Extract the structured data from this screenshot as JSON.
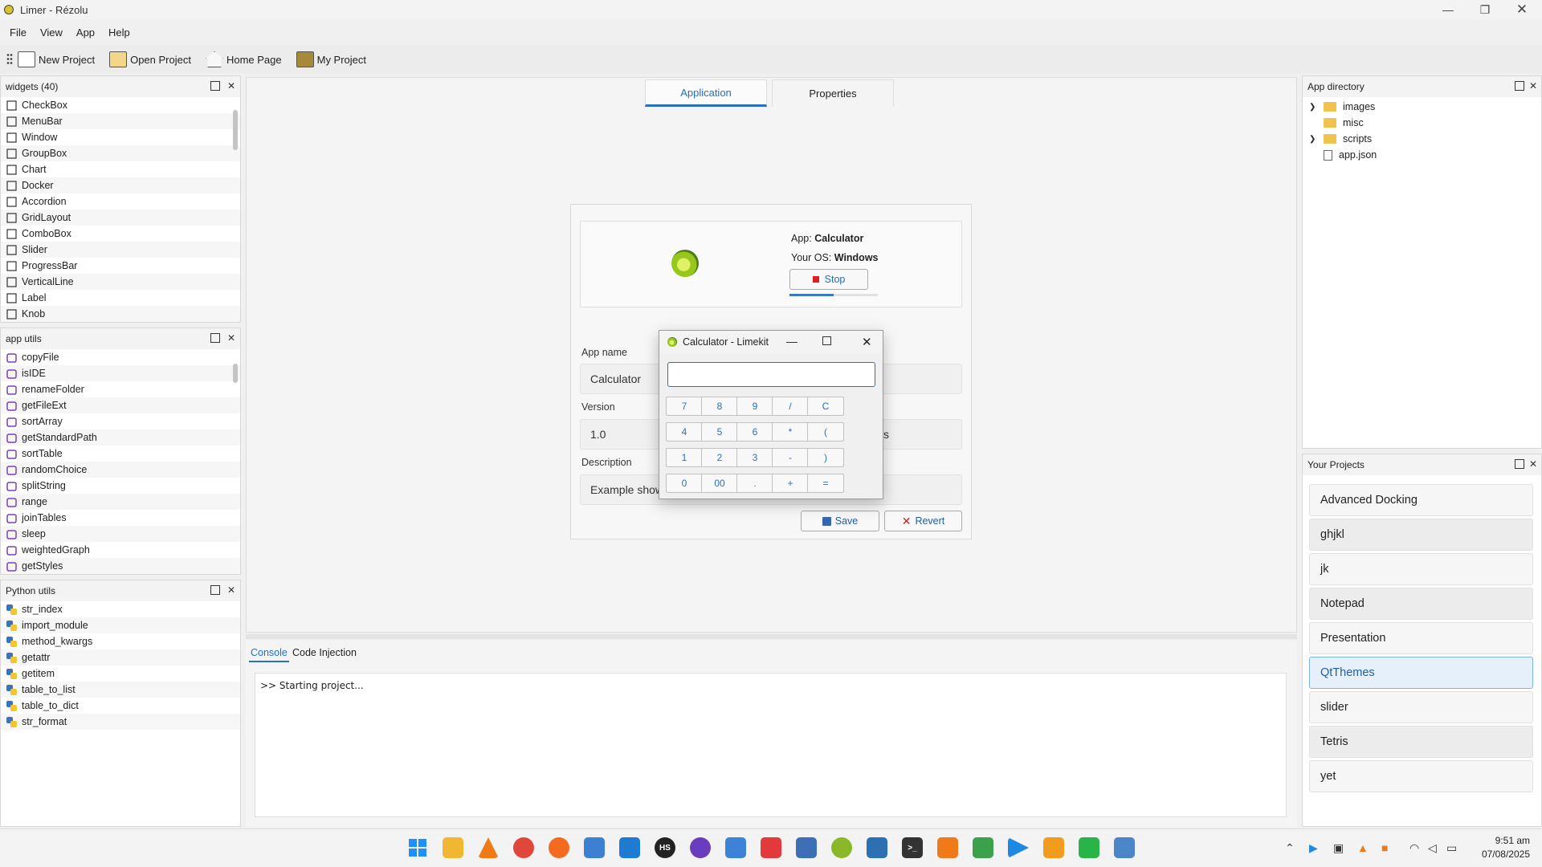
{
  "window": {
    "title": "Limer - Rézolu"
  },
  "menu": [
    "File",
    "View",
    "App",
    "Help"
  ],
  "toolbar": {
    "new_project": "New Project",
    "open_project": "Open Project",
    "home_page": "Home Page",
    "my_project": "My Project"
  },
  "widgets": {
    "title": "widgets (40)",
    "items": [
      "CheckBox",
      "MenuBar",
      "Window",
      "GroupBox",
      "Chart",
      "Docker",
      "Accordion",
      "GridLayout",
      "ComboBox",
      "Slider",
      "ProgressBar",
      "VerticalLine",
      "Label",
      "Knob"
    ]
  },
  "app_utils": {
    "title": "app utils",
    "items": [
      "copyFile",
      "isIDE",
      "renameFolder",
      "getFileExt",
      "sortArray",
      "getStandardPath",
      "sortTable",
      "randomChoice",
      "splitString",
      "range",
      "joinTables",
      "sleep",
      "weightedGraph",
      "getStyles"
    ]
  },
  "python_utils": {
    "title": "Python utils",
    "items": [
      "str_index",
      "import_module",
      "method_kwargs",
      "getattr",
      "getitem",
      "table_to_list",
      "table_to_dict",
      "str_format"
    ]
  },
  "tabs": {
    "application": "Application",
    "properties": "Properties"
  },
  "info": {
    "app_label": "App:",
    "app_value": "Calculator",
    "os_label": "Your OS:",
    "os_value": "Windows",
    "stop": "Stop",
    "progress": 0.5
  },
  "form": {
    "app_name_label": "App name",
    "app_name_value": "Calculator",
    "version_label": "Version",
    "version_value": "1.0",
    "version_suffix": "s",
    "description_label": "Description",
    "description_value": "Example show",
    "save": "Save",
    "revert": "Revert"
  },
  "calculator": {
    "title": "Calculator - Limekit",
    "display": "",
    "keys": [
      [
        "7",
        "8",
        "9",
        "/",
        "C"
      ],
      [
        "4",
        "5",
        "6",
        "*",
        "("
      ],
      [
        "1",
        "2",
        "3",
        "-",
        ")"
      ],
      [
        "0",
        "00",
        ".",
        "+",
        "="
      ]
    ]
  },
  "console": {
    "tabs": [
      "Console",
      "Code Injection"
    ],
    "output": ">> Starting project..."
  },
  "app_directory": {
    "title": "App directory",
    "items": [
      {
        "name": "images",
        "folder": true,
        "expandable": true
      },
      {
        "name": "misc",
        "folder": true,
        "expandable": false
      },
      {
        "name": "scripts",
        "folder": true,
        "expandable": true
      },
      {
        "name": "app.json",
        "folder": false,
        "expandable": false
      }
    ]
  },
  "projects": {
    "title": "Your Projects",
    "items": [
      "Advanced Docking",
      "ghjkl",
      "jk",
      "Notepad",
      "Presentation",
      "QtThemes",
      "slider",
      "Tetris",
      "yet"
    ],
    "selected": "QtThemes"
  },
  "clock": {
    "time": "9:51 am",
    "date": "07/08/2025"
  },
  "colors": {
    "accent": "#2a6fc5",
    "stop": "#e02020",
    "revert": "#d32020"
  }
}
